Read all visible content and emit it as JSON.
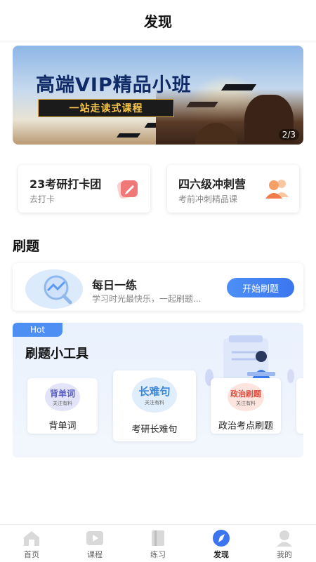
{
  "header": {
    "title": "发现"
  },
  "banner": {
    "title": "高端VIP精品小班",
    "subtitle": "一站走读式课程",
    "indicator": "2/3"
  },
  "cards": [
    {
      "title": "23考研打卡团",
      "subtitle": "去打卡",
      "icon": "pencil-note-icon",
      "accent": "#f07878"
    },
    {
      "title": "四六级冲刺营",
      "subtitle": "考前冲刺精品课",
      "icon": "users-icon",
      "accent": "#f5a066"
    }
  ],
  "section": {
    "title": "刷题"
  },
  "daily": {
    "title": "每日一练",
    "subtitle": "学习时光最快乐，一起刷题...",
    "button": "开始刷题"
  },
  "tools": {
    "hot_label": "Hot",
    "title": "刷题小工具",
    "items": [
      {
        "label": "背单词",
        "badge_text": "背单词",
        "badge_sub": "关注有料",
        "color": "#5b5fc7",
        "bg": "#e3e4f8"
      },
      {
        "label": "考研长难句",
        "badge_text": "长难句",
        "badge_sub": "关注有料",
        "color": "#3b86d8",
        "bg": "#e0eefb"
      },
      {
        "label": "政治考点刷题",
        "badge_text": "政治刷题",
        "badge_sub": "关注有料",
        "color": "#e04b3b",
        "bg": "#fde4df"
      }
    ]
  },
  "tabbar": {
    "items": [
      {
        "label": "首页",
        "icon": "home-icon",
        "active": false
      },
      {
        "label": "课程",
        "icon": "play-icon",
        "active": false
      },
      {
        "label": "练习",
        "icon": "book-icon",
        "active": false
      },
      {
        "label": "发现",
        "icon": "compass-icon",
        "active": true
      },
      {
        "label": "我的",
        "icon": "user-icon",
        "active": false
      }
    ]
  },
  "colors": {
    "primary": "#3b76f0",
    "hot": "#4e8ff4"
  }
}
